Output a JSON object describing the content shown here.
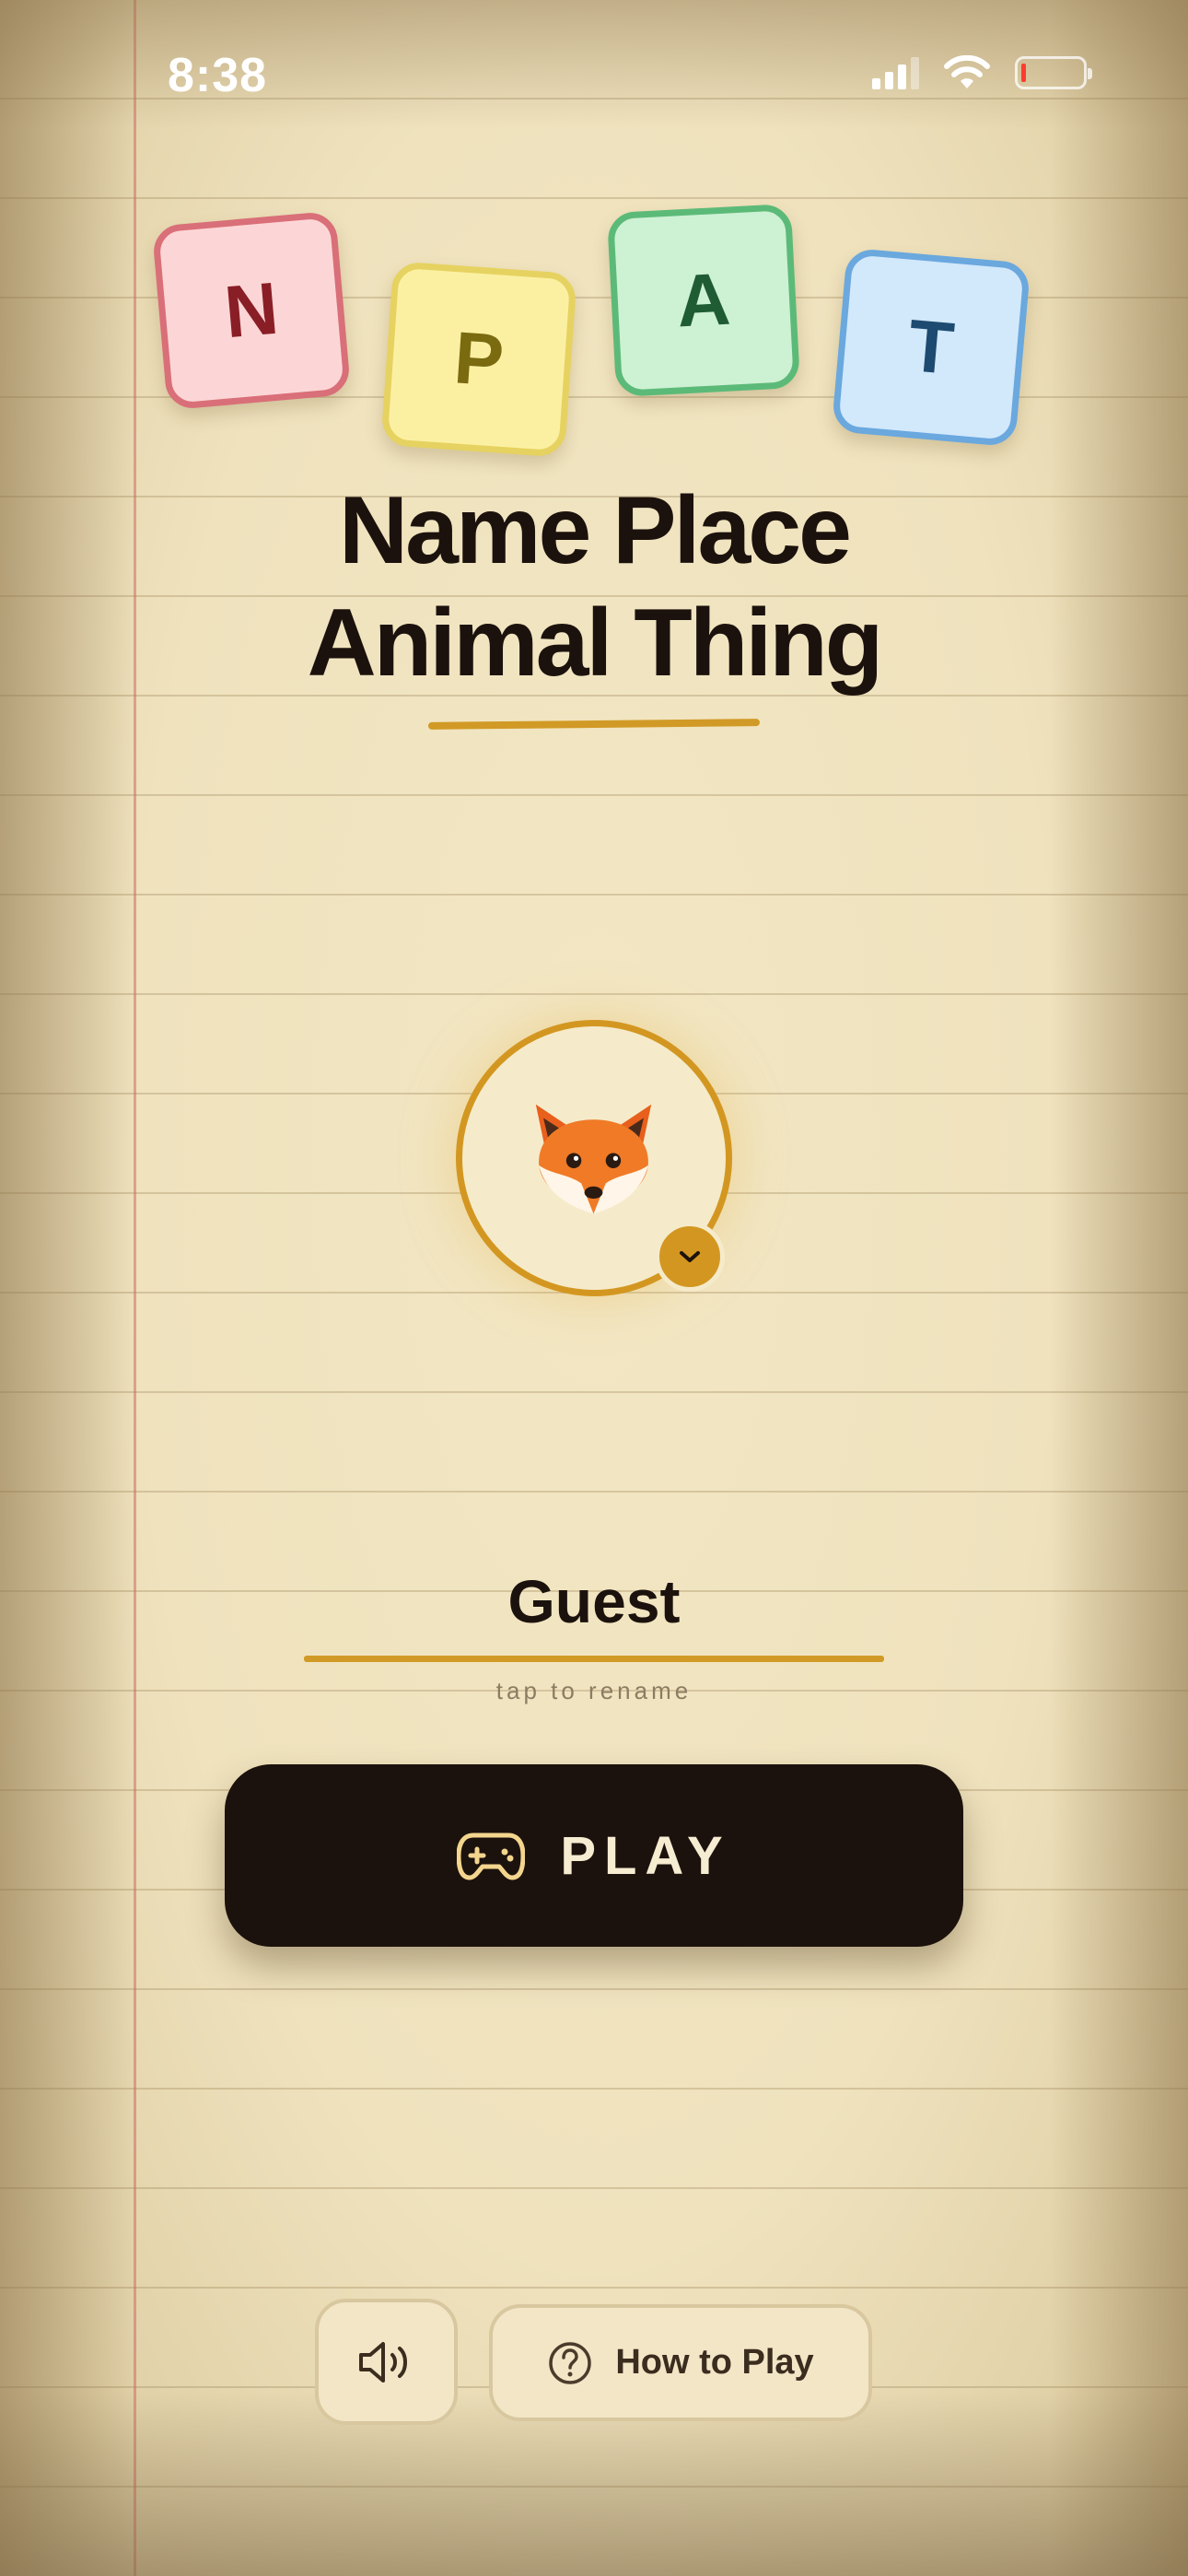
{
  "status_bar": {
    "time": "8:38",
    "icons": [
      "signal-icon",
      "wifi-icon",
      "battery-icon"
    ]
  },
  "tiles": [
    {
      "letter": "N",
      "color": "#fcd6d6"
    },
    {
      "letter": "P",
      "color": "#fbf0a2"
    },
    {
      "letter": "A",
      "color": "#cdf1d3"
    },
    {
      "letter": "T",
      "color": "#d2e8fb"
    }
  ],
  "title": {
    "line1": "Name Place",
    "line2": "Animal Thing"
  },
  "avatar": {
    "emoji": "fox-face-icon",
    "picker_icon": "chevron-down-icon"
  },
  "player": {
    "name": "Guest",
    "hint": "tap to rename"
  },
  "play_button": {
    "icon": "gamepad-icon",
    "label": "PLAY"
  },
  "bottom_bar": {
    "sound_icon": "speaker-icon",
    "howto_icon": "question-circle-icon",
    "howto_label": "How to Play"
  },
  "colors": {
    "accent": "#d39721",
    "ink": "#1c120d",
    "paper": "#efe2bd"
  }
}
